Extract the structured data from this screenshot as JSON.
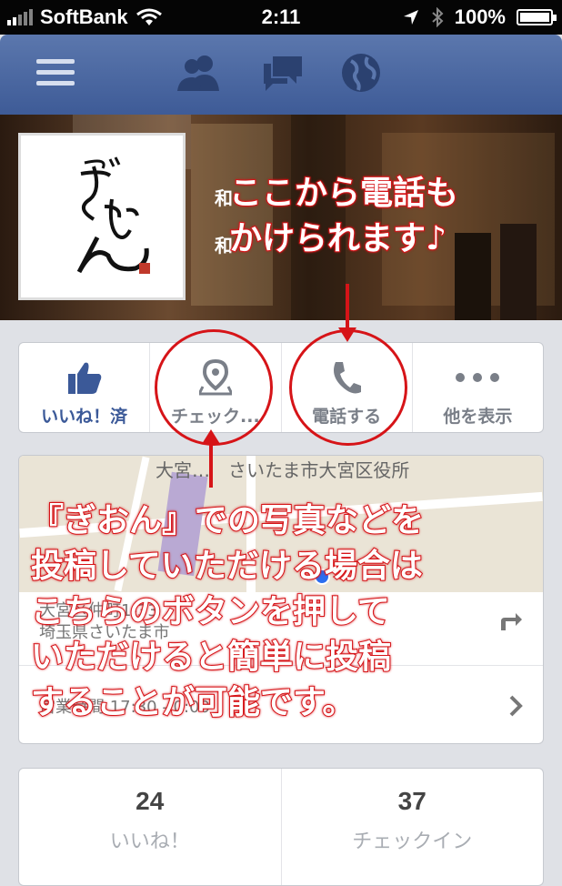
{
  "status_bar": {
    "carrier": "SoftBank",
    "time": "2:11",
    "battery": "100%"
  },
  "nav": {
    "icons": [
      "menu-icon",
      "friend-requests-icon",
      "messages-icon",
      "notifications-globe-icon"
    ]
  },
  "page": {
    "cover_text_1": "和",
    "cover_text_2": "和"
  },
  "actions": [
    {
      "label": "いいね！済",
      "icon": "thumbs-up-icon",
      "color": "#3b5998"
    },
    {
      "label": "チェック...",
      "icon": "map-pin-icon",
      "color": "#7a7f88"
    },
    {
      "label": "電話する",
      "icon": "phone-icon",
      "color": "#7a7f88"
    },
    {
      "label": "他を表示",
      "icon": "more-icon",
      "color": "#7a7f88"
    }
  ],
  "info": {
    "map_label": "大宮…　さいたま市大宮区役所",
    "address_line1": "大宮区仲町1-33",
    "address_line2": "埼玉県さいたま市",
    "hours": "営業時間 17:30 - 0:00"
  },
  "stats": [
    {
      "value": "24",
      "label": "いいね！"
    },
    {
      "value": "37",
      "label": "チェックイン"
    }
  ],
  "annotations": {
    "phone_note_line1": "ここから電話も",
    "phone_note_line2": "かけられます♪",
    "checkin_note": [
      "『ぎおん』での写真などを",
      "投稿していただける場合は",
      "こちらのボタンを押して",
      "いただけると簡単に投稿",
      "することが可能です。"
    ]
  },
  "colors": {
    "facebook_blue": "#3b5998",
    "annotation_red": "#d61418"
  }
}
